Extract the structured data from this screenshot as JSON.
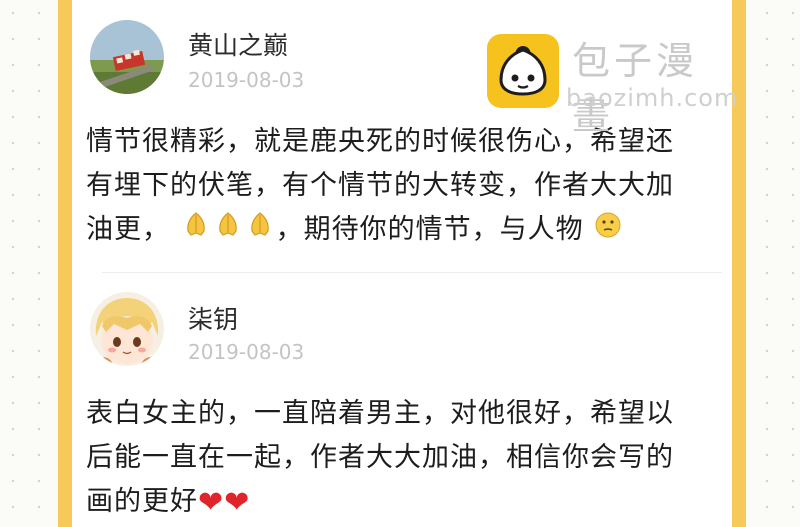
{
  "comments": [
    {
      "username": "黄山之巅",
      "date": "2019-08-03",
      "line1": "情节很精彩，就是鹿央死的时候很伤心，希望还",
      "line2": "有埋下的伏笔，有个情节的大转变，作者大大加",
      "line3a": "油更，",
      "line3b": "，期待你的情节，与人物"
    },
    {
      "username": "柒钥",
      "date": "2019-08-03",
      "line1": "表白女主的，一直陪着男主，对他很好，希望以",
      "line2": "后能一直在一起，作者大大加油，相信你会写的",
      "line3": "画的更好",
      "hearts": "❤❤"
    }
  ],
  "watermark": {
    "name": "包子漫畫",
    "url": "baozimh.com"
  },
  "colors": {
    "accent": "#f7c95a",
    "logo_yellow": "#f6c21d",
    "heart_red": "#e0242b"
  },
  "icons": [
    "praying-hands-emoji",
    "thinking-face-emoji",
    "heart-emoji",
    "bun-logo-icon"
  ]
}
